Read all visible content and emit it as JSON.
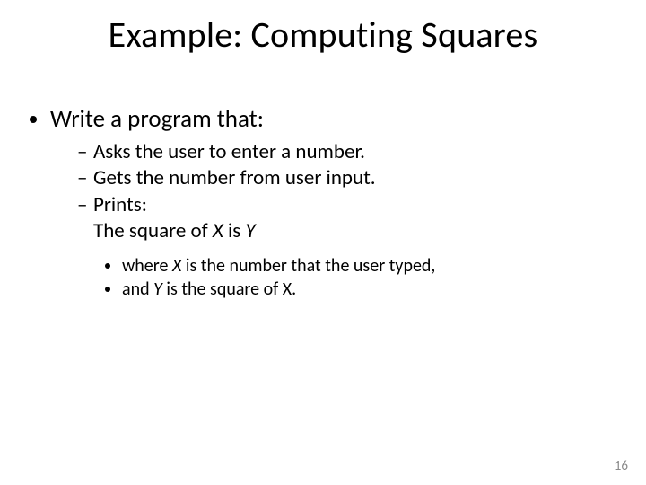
{
  "title": "Example: Computing Squares",
  "l1_item": "Write a program that:",
  "l2": {
    "a": "Asks the user to enter a number.",
    "b": "Gets the number from user input.",
    "c": "Prints:",
    "c_cont_pre": "The square of ",
    "c_cont_x": "X",
    "c_cont_mid": " is ",
    "c_cont_y": "Y"
  },
  "l3": {
    "a_pre": "where ",
    "a_x": "X",
    "a_post": " is the number that the user typed,",
    "b_pre": "and ",
    "b_y": "Y",
    "b_post": " is the square of X."
  },
  "page_number": "16"
}
